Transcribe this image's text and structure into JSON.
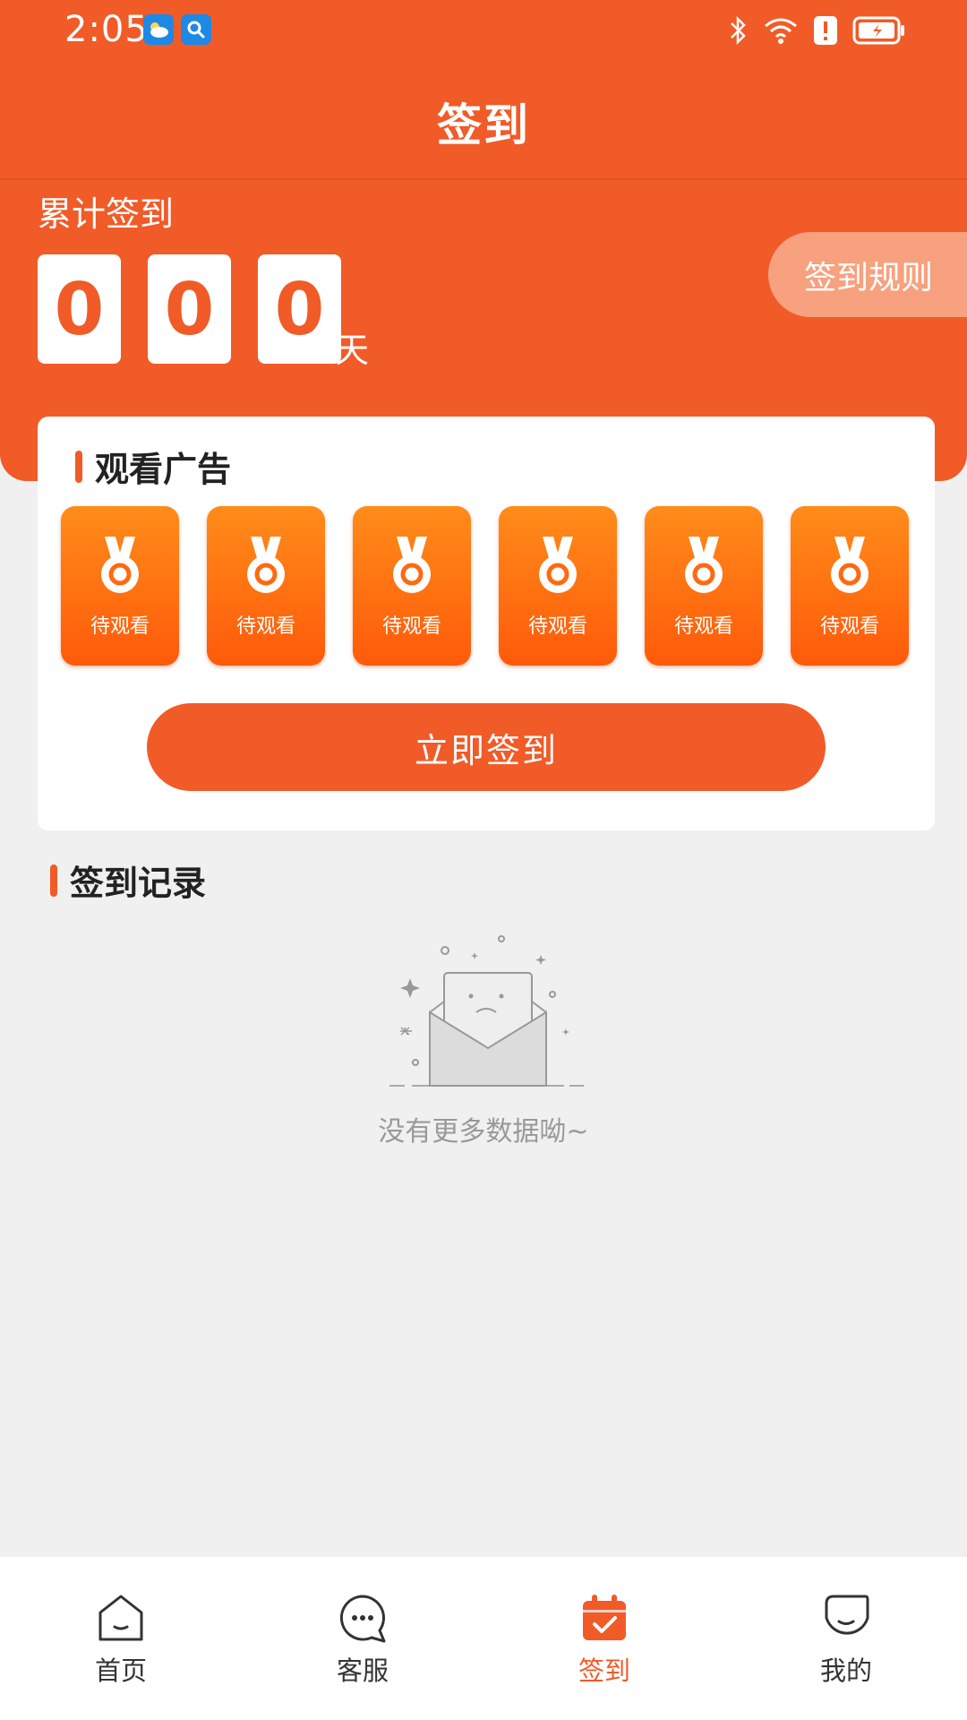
{
  "status_bar": {
    "time": "2:05"
  },
  "header": {
    "title": "签到"
  },
  "summary": {
    "label": "累计签到",
    "digits": [
      "0",
      "0",
      "0"
    ],
    "unit": "天",
    "rules_label": "签到规则"
  },
  "ads": {
    "title": "观看广告",
    "tiles": [
      {
        "label": "待观看"
      },
      {
        "label": "待观看"
      },
      {
        "label": "待观看"
      },
      {
        "label": "待观看"
      },
      {
        "label": "待观看"
      },
      {
        "label": "待观看"
      }
    ],
    "checkin_label": "立即签到"
  },
  "records": {
    "title": "签到记录",
    "empty_text": "没有更多数据呦~"
  },
  "tabbar": {
    "items": [
      {
        "label": "首页",
        "icon": "home-icon",
        "active": false
      },
      {
        "label": "客服",
        "icon": "chat-icon",
        "active": false
      },
      {
        "label": "签到",
        "icon": "calendar-check-icon",
        "active": true
      },
      {
        "label": "我的",
        "icon": "profile-icon",
        "active": false
      }
    ]
  },
  "colors": {
    "accent": "#f05b28",
    "background": "#f0f0f0",
    "tile_top": "#ff8c1a",
    "tile_bottom": "#ff5a0a"
  }
}
